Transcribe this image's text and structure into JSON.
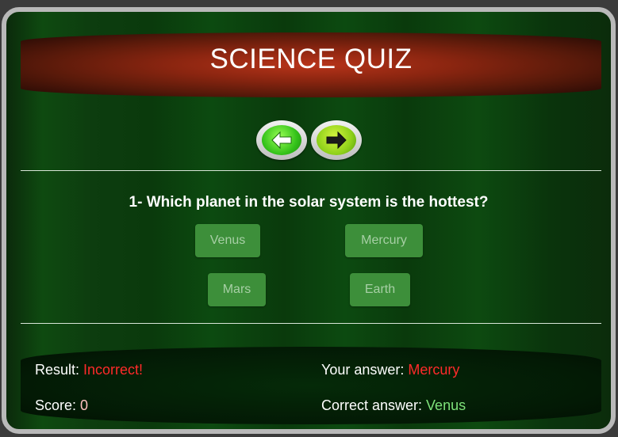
{
  "header": {
    "title": "SCIENCE QUIZ"
  },
  "nav": {
    "prev_icon": "arrow-left-icon",
    "next_icon": "arrow-right-icon"
  },
  "question": {
    "text": "1- Which planet in the solar system is the hottest?"
  },
  "options": [
    "Venus",
    "Mercury",
    "Mars",
    "Earth"
  ],
  "result": {
    "result_label": "Result: ",
    "result_value": "Incorrect!",
    "score_label": "Score: ",
    "score_value": "0",
    "your_answer_label": "Your answer: ",
    "your_answer_value": "Mercury",
    "correct_answer_label": "Correct answer: ",
    "correct_answer_value": "Venus"
  },
  "colors": {
    "incorrect": "#ff2a2a",
    "correct": "#7ee27a",
    "option_bg": "#3d8f3a"
  }
}
